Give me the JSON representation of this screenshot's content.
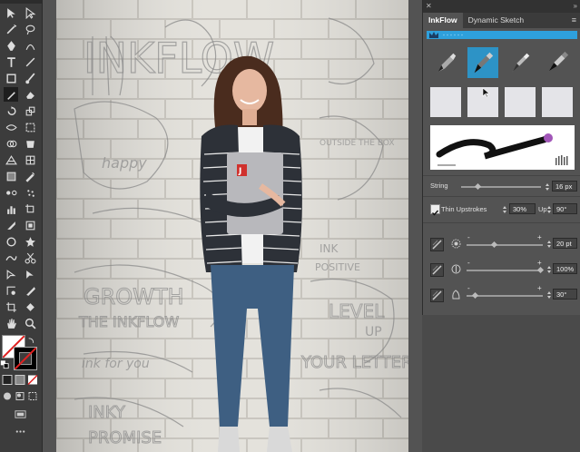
{
  "panel": {
    "tabs": [
      {
        "label": "InkFlow"
      },
      {
        "label": "Dynamic Sketch"
      }
    ],
    "string": {
      "label": "String",
      "value": "16 px"
    },
    "thin_upstrokes": {
      "label": "Thin Upstrokes",
      "checked": true,
      "percent": "30%",
      "up_label": "Up",
      "up_value": "90°"
    },
    "rows": [
      {
        "value": "20 pt",
        "icon": "size-circle-icon"
      },
      {
        "value": "100%",
        "icon": "opacity-drop-icon"
      },
      {
        "value": "30°",
        "icon": "angle-icon"
      }
    ]
  },
  "artboard_text": {
    "doodles": [
      "INKFLOW",
      "happy",
      "GROWTH",
      "INK",
      "POSITIVE",
      "THE INKFLOW",
      "LEVEL",
      "UP",
      "YOUR LETTERING",
      "ink for you",
      "INKY",
      "PROMISE",
      "OUTSIDE THE BOX"
    ],
    "laptop_badge": "J"
  },
  "colors": {
    "accent": "#2ea0dc",
    "selected_brush": "#2d93c6",
    "toolbar_bg": "#3c3c3c",
    "panel_bg": "#535353",
    "stroke_end": "#a156b8"
  }
}
